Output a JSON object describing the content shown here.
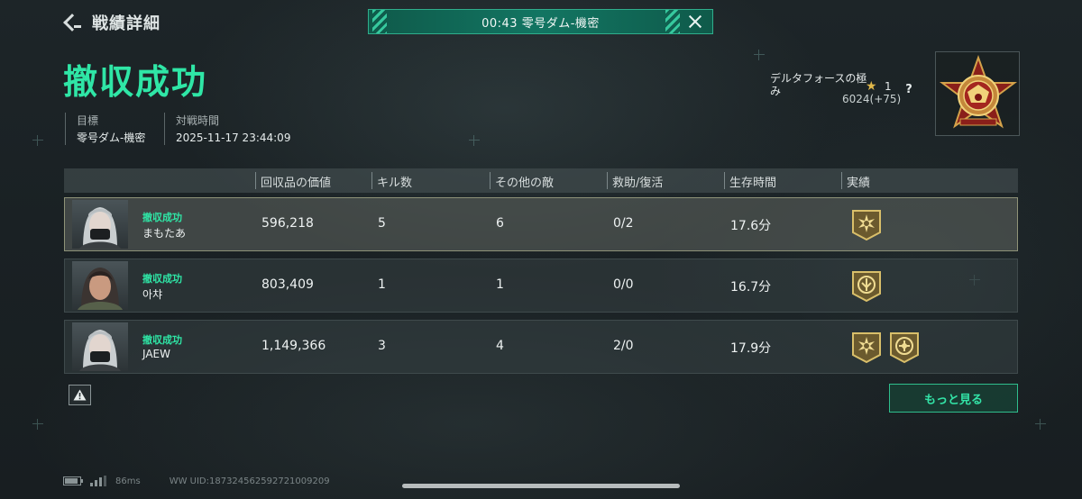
{
  "header": {
    "back_label": "戦績詳細",
    "banner_text": "00:43  零号ダム-機密"
  },
  "result": {
    "title": "撤収成功",
    "target_label": "目標",
    "target_value": "零号ダム-機密",
    "time_label": "対戦時間",
    "time_value": "2025-11-17 23:44:09"
  },
  "rank": {
    "name": "デルタフォースの極み",
    "stars": "1",
    "points": "6024(+75)",
    "help": "?"
  },
  "table": {
    "columns": [
      "回収品の価値",
      "キル数",
      "その他の敵",
      "救助/復活",
      "生存時間",
      "実績"
    ],
    "rows": [
      {
        "status": "撤収成功",
        "name": "まもたあ",
        "value": "596,218",
        "kills": "5",
        "other": "6",
        "rescue": "0/2",
        "survival": "17.6分",
        "badges": [
          "sun-badge-icon"
        ]
      },
      {
        "status": "撤収成功",
        "name": "아챠",
        "value": "803,409",
        "kills": "1",
        "other": "1",
        "rescue": "0/0",
        "survival": "16.7分",
        "badges": [
          "shield-badge-icon"
        ]
      },
      {
        "status": "撤収成功",
        "name": "JAEW",
        "value": "1,149,366",
        "kills": "3",
        "other": "4",
        "rescue": "2/0",
        "survival": "17.9分",
        "badges": [
          "sun-badge-icon",
          "emblem-badge-icon"
        ]
      }
    ]
  },
  "actions": {
    "more_label": "もっと見る"
  },
  "footer": {
    "ping": "86ms",
    "uid": "WW UID:1873245625927210092​09"
  },
  "colors": {
    "accent": "#2fe6a6",
    "banner": "#127562"
  }
}
